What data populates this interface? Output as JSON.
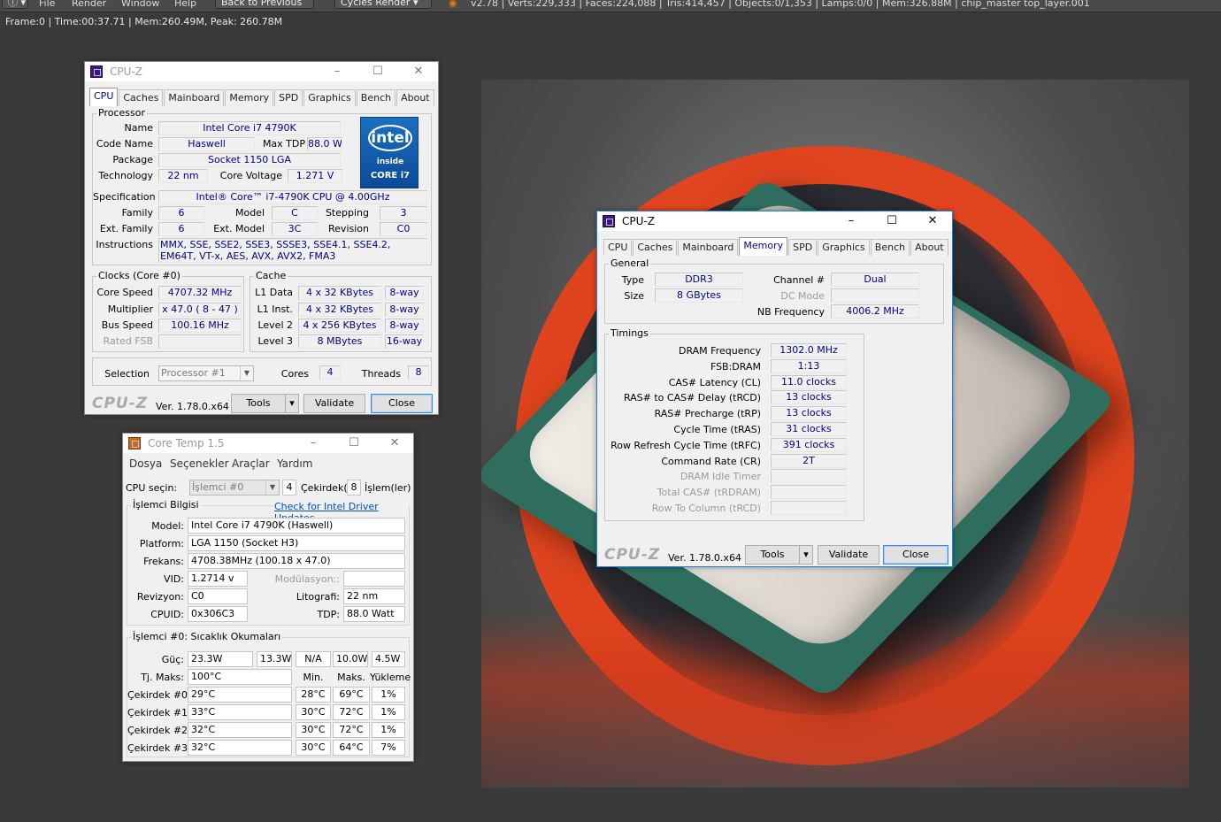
{
  "blender": {
    "menus": [
      "File",
      "Render",
      "Window",
      "Help"
    ],
    "back_button": "Back to Previous",
    "engine": "Cycles Render",
    "stats": "v2.78 | Verts:229,333 | Faces:224,088 | Tris:414,457 | Objects:0/1,353 | Lamps:0/0 | Mem:326.88M | chip_master top_layer.001",
    "render_info": "Frame:0 | Time:00:37.71 | Mem:260.49M, Peak: 260.78M"
  },
  "cpuz1": {
    "title": "CPU-Z",
    "tabs": [
      "CPU",
      "Caches",
      "Mainboard",
      "Memory",
      "SPD",
      "Graphics",
      "Bench",
      "About"
    ],
    "processor_group": "Processor",
    "name_label": "Name",
    "name": "Intel Core i7 4790K",
    "codename_label": "Code Name",
    "codename": "Haswell",
    "maxtdp_label": "Max TDP",
    "maxtdp": "88.0 W",
    "package_label": "Package",
    "package": "Socket 1150 LGA",
    "technology_label": "Technology",
    "technology": "22 nm",
    "corevoltage_label": "Core Voltage",
    "corevoltage": "1.271 V",
    "spec_label": "Specification",
    "spec": "Intel® Core™ i7-4790K CPU @ 4.00GHz",
    "family_label": "Family",
    "family": "6",
    "model_label": "Model",
    "model": "C",
    "stepping_label": "Stepping",
    "stepping": "3",
    "extfamily_label": "Ext. Family",
    "extfamily": "6",
    "extmodel_label": "Ext. Model",
    "extmodel": "3C",
    "revision_label": "Revision",
    "revision": "C0",
    "instructions_label": "Instructions",
    "instructions": "MMX, SSE, SSE2, SSE3, SSSE3, SSE4.1, SSE4.2, EM64T, VT-x, AES, AVX, AVX2, FMA3",
    "intel_logo": {
      "word": "intel",
      "inside": "inside",
      "core": "CORE i7"
    },
    "clocks_group": "Clocks (Core #0)",
    "corespeed_label": "Core Speed",
    "corespeed": "4707.32 MHz",
    "multiplier_label": "Multiplier",
    "multiplier": "x 47.0 ( 8 - 47 )",
    "busspeed_label": "Bus Speed",
    "busspeed": "100.16 MHz",
    "ratedfsb_label": "Rated FSB",
    "ratedfsb": "",
    "cache_group": "Cache",
    "l1data_label": "L1 Data",
    "l1data": "4 x 32 KBytes",
    "l1data_way": "8-way",
    "l1inst_label": "L1 Inst.",
    "l1inst": "4 x 32 KBytes",
    "l1inst_way": "8-way",
    "level2_label": "Level 2",
    "level2": "4 x 256 KBytes",
    "level2_way": "8-way",
    "level3_label": "Level 3",
    "level3": "8 MBytes",
    "level3_way": "16-way",
    "selection_label": "Selection",
    "selection": "Processor #1",
    "cores_label": "Cores",
    "cores": "4",
    "threads_label": "Threads",
    "threads": "8",
    "brand": "CPU-Z",
    "version": "Ver. 1.78.0.x64",
    "tools": "Tools",
    "validate": "Validate",
    "close": "Close"
  },
  "cpuz2": {
    "title": "CPU-Z",
    "tabs": [
      "CPU",
      "Caches",
      "Mainboard",
      "Memory",
      "SPD",
      "Graphics",
      "Bench",
      "About"
    ],
    "general_group": "General",
    "type_label": "Type",
    "type": "DDR3",
    "size_label": "Size",
    "size": "8 GBytes",
    "channel_label": "Channel #",
    "channel": "Dual",
    "dcmode_label": "DC Mode",
    "dcmode": "",
    "nbfreq_label": "NB Frequency",
    "nbfreq": "4006.2 MHz",
    "timings_group": "Timings",
    "timings": [
      {
        "label": "DRAM Frequency",
        "value": "1302.0 MHz",
        "gray": false
      },
      {
        "label": "FSB:DRAM",
        "value": "1:13",
        "gray": false
      },
      {
        "label": "CAS# Latency (CL)",
        "value": "11.0 clocks",
        "gray": false
      },
      {
        "label": "RAS# to CAS# Delay (tRCD)",
        "value": "13 clocks",
        "gray": false
      },
      {
        "label": "RAS# Precharge (tRP)",
        "value": "13 clocks",
        "gray": false
      },
      {
        "label": "Cycle Time (tRAS)",
        "value": "31 clocks",
        "gray": false
      },
      {
        "label": "Row Refresh Cycle Time (tRFC)",
        "value": "391 clocks",
        "gray": false
      },
      {
        "label": "Command Rate (CR)",
        "value": "2T",
        "gray": false
      },
      {
        "label": "DRAM Idle Timer",
        "value": "",
        "gray": true
      },
      {
        "label": "Total CAS# (tRDRAM)",
        "value": "",
        "gray": true
      },
      {
        "label": "Row To Column (tRCD)",
        "value": "",
        "gray": true
      }
    ],
    "brand": "CPU-Z",
    "version": "Ver. 1.78.0.x64",
    "tools": "Tools",
    "validate": "Validate",
    "close": "Close"
  },
  "coretemp": {
    "title": "Core Temp 1.5",
    "menus": [
      "Dosya",
      "Seçenekler",
      "Araçlar",
      "Yardım"
    ],
    "cpu_select_label": "CPU seçin:",
    "cpu_select": "İşlemci #0",
    "cores": "4",
    "cores_label": "Çekirdek(le",
    "threads": "8",
    "threads_label": "İşlem(ler)",
    "info_group": "İşlemci Bilgisi",
    "driver_link": "Check for Intel Driver Updates",
    "model_label": "Model:",
    "model": "Intel Core i7 4790K (Haswell)",
    "platform_label": "Platform:",
    "platform": "LGA 1150 (Socket H3)",
    "freq_label": "Frekans:",
    "freq": "4708.38MHz (100.18 x 47.0)",
    "vid_label": "VID:",
    "vid": "1.2714 v",
    "modulation_label": "Modülasyon::",
    "modulation": "",
    "revision_label": "Revizyon:",
    "revision": "C0",
    "litho_label": "Litografi:",
    "litho": "22 nm",
    "cpuid_label": "CPUID:",
    "cpuid": "0x306C3",
    "tdp_label": "TDP:",
    "tdp": "88.0 Watt",
    "temps_group": "İşlemci #0: Sıcaklık Okumaları",
    "power_label": "Güç:",
    "power": [
      "23.3W",
      "13.3W",
      "N/A",
      "10.0W",
      "4.5W"
    ],
    "tjmax_label": "Tj. Maks:",
    "tjmax": "100°C",
    "min_hdr": "Min.",
    "max_hdr": "Maks.",
    "load_hdr": "Yükleme",
    "cores_rows": [
      {
        "label": "Çekirdek #0:",
        "temp": "29°C",
        "min": "28°C",
        "max": "69°C",
        "load": "1%"
      },
      {
        "label": "Çekirdek #1:",
        "temp": "33°C",
        "min": "30°C",
        "max": "72°C",
        "load": "1%"
      },
      {
        "label": "Çekirdek #2:",
        "temp": "32°C",
        "min": "30°C",
        "max": "72°C",
        "load": "1%"
      },
      {
        "label": "Çekirdek #3:",
        "temp": "32°C",
        "min": "30°C",
        "max": "64°C",
        "load": "7%"
      }
    ]
  }
}
